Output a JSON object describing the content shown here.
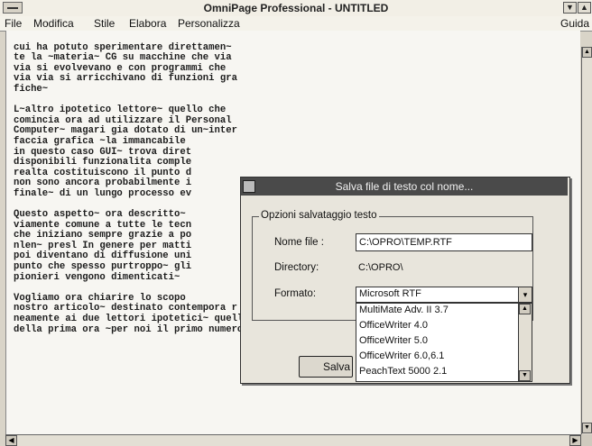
{
  "window": {
    "title": "OmniPage Professional - UNTITLED"
  },
  "menubar": {
    "items": [
      {
        "label": "File"
      },
      {
        "label": "Modifica"
      },
      {
        "label": "Stile"
      },
      {
        "label": "Elabora"
      },
      {
        "label": "Personalizza"
      }
    ],
    "help": "Guida"
  },
  "document": {
    "lines": [
      "cui ha potuto sperimentare direttamen~",
      "te la ~materia~ CG su macchine che via",
      "via si evolvevano e con programmi che",
      "via via si arricchivano di funzioni gra",
      "fiche~",
      "",
      "L~altro ipotetico lettore~ quello che",
      "comincia ora ad utilizzare il Personal",
      "Computer~ magari gia dotato di un~inter",
      "faccia grafica ~la immancabile",
      "in questo caso GUI~ trova diret",
      "disponibili funzionalita comple",
      "realta costituiscono il punto d",
      "non sono ancora probabilmente i",
      "finale~ di un lungo processo ev",
      "",
      "Questo aspetto~ ora descritto~",
      "viamente comune a tutte le tecn",
      "che iniziano sempre grazie a po",
      "nlen~ presl In genere per matti",
      "poi diventano di diffusione uni",
      "punto che spesso purtroppo~ gli",
      "pionieri vengono dimenticati~",
      "",
      "Vogliamo ora chiarire lo scopo",
      "nostro articolo~ destinato contempora r",
      "neamente ai due lettori ipotetici~ quello",
      "della prima ora ~per noi il primo numero~"
    ]
  },
  "dialog": {
    "title": "Salva file di testo col nome...",
    "group_label": "Opzioni salvataggio testo",
    "filename_label": "Nome file :",
    "filename_value": "C:\\OPRO\\TEMP.RTF",
    "directory_label": "Directory:",
    "directory_value": "C:\\OPRO\\",
    "format_label": "Formato:",
    "format_value": "Microsoft RTF",
    "format_options": [
      "MultiMate Adv. II 3.7",
      "OfficeWriter 4.0",
      "OfficeWriter 5.0",
      "OfficeWriter 6.0,6.1",
      "PeachText 5000 2.1"
    ],
    "save_label": "Salva"
  }
}
